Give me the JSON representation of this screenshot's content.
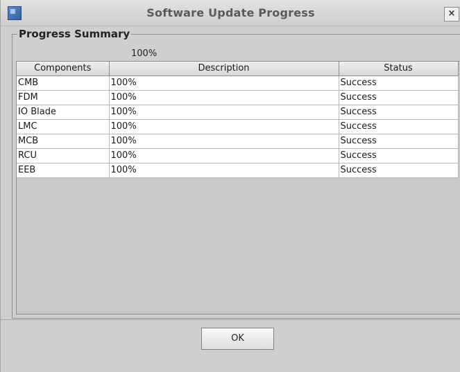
{
  "window": {
    "title": "Software Update Progress",
    "close_glyph": "×"
  },
  "summary": {
    "legend": "Progress Summary",
    "overall_progress": "100%"
  },
  "table": {
    "headers": [
      "Components",
      "Description",
      "Status"
    ],
    "rows": [
      [
        "CMB",
        "100%",
        "Success"
      ],
      [
        "FDM",
        "100%",
        "Success"
      ],
      [
        "IO Blade",
        "100%",
        "Success"
      ],
      [
        "LMC",
        "100%",
        "Success"
      ],
      [
        "MCB",
        "100%",
        "Success"
      ],
      [
        "RCU",
        "100%",
        "Success"
      ],
      [
        "EEB",
        "100%",
        "Success"
      ]
    ]
  },
  "buttons": {
    "ok_label": "OK"
  },
  "icons": {
    "app": "app-icon",
    "close": "close-icon"
  }
}
